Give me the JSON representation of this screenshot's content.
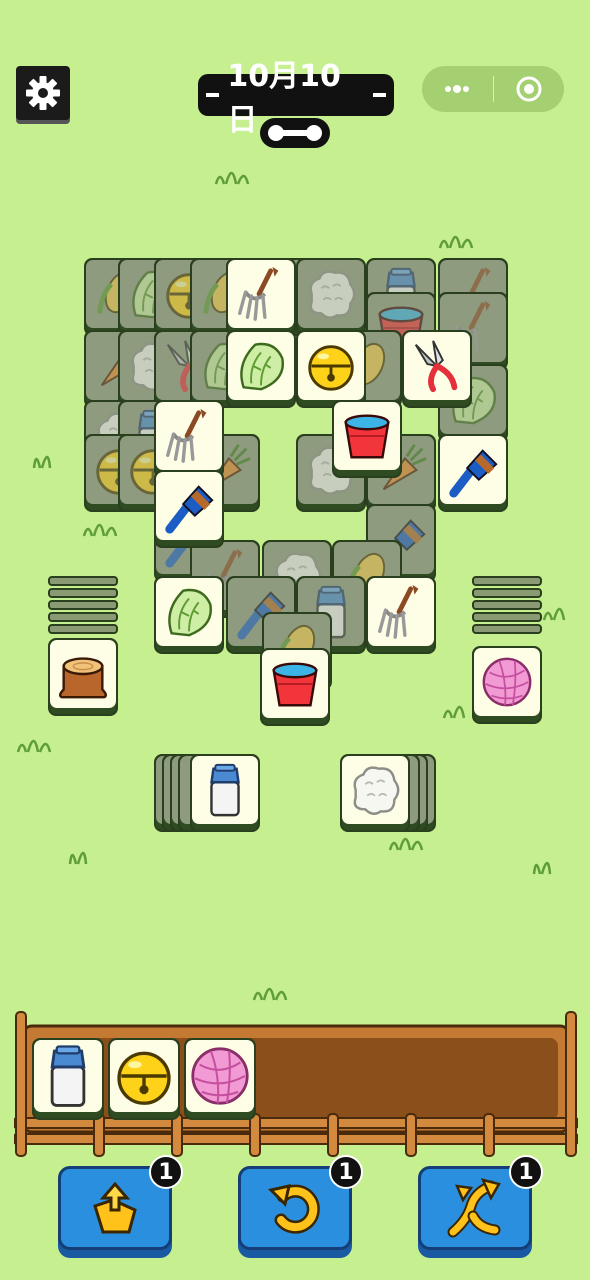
{
  "header": {
    "date": "10月10日",
    "settings_icon": "gear-icon",
    "capsule": {
      "more_icon": "more-dots-icon",
      "close_icon": "target-circle-icon"
    }
  },
  "board": {
    "top_tiles": [
      {
        "id": "t1",
        "item": "pitchfork"
      },
      {
        "id": "t2",
        "item": "cabbage"
      },
      {
        "id": "t3",
        "item": "bell"
      },
      {
        "id": "t4",
        "item": "shears"
      },
      {
        "id": "t5",
        "item": "pitchfork"
      },
      {
        "id": "t6",
        "item": "bucket"
      },
      {
        "id": "t7",
        "item": "brush"
      },
      {
        "id": "t8",
        "item": "brush"
      },
      {
        "id": "t9",
        "item": "cabbage"
      },
      {
        "id": "t10",
        "item": "pitchfork"
      },
      {
        "id": "t11",
        "item": "bucket"
      },
      {
        "id": "t12",
        "item": "stump"
      },
      {
        "id": "t13",
        "item": "yarn"
      },
      {
        "id": "t14",
        "item": "milk"
      },
      {
        "id": "t15",
        "item": "wool"
      }
    ]
  },
  "tray": {
    "slots": [
      {
        "item": "milk"
      },
      {
        "item": "bell"
      },
      {
        "item": "yarn"
      }
    ],
    "capacity": 7
  },
  "powerups": [
    {
      "name": "move-out",
      "icon": "lift-out-icon",
      "count": "1"
    },
    {
      "name": "undo",
      "icon": "undo-arrow-icon",
      "count": "1"
    },
    {
      "name": "shuffle",
      "icon": "shuffle-icon",
      "count": "1"
    }
  ],
  "colors": {
    "background": "#c6ef8f",
    "tile_face": "#fefde6",
    "button": "#2b8fe0"
  }
}
